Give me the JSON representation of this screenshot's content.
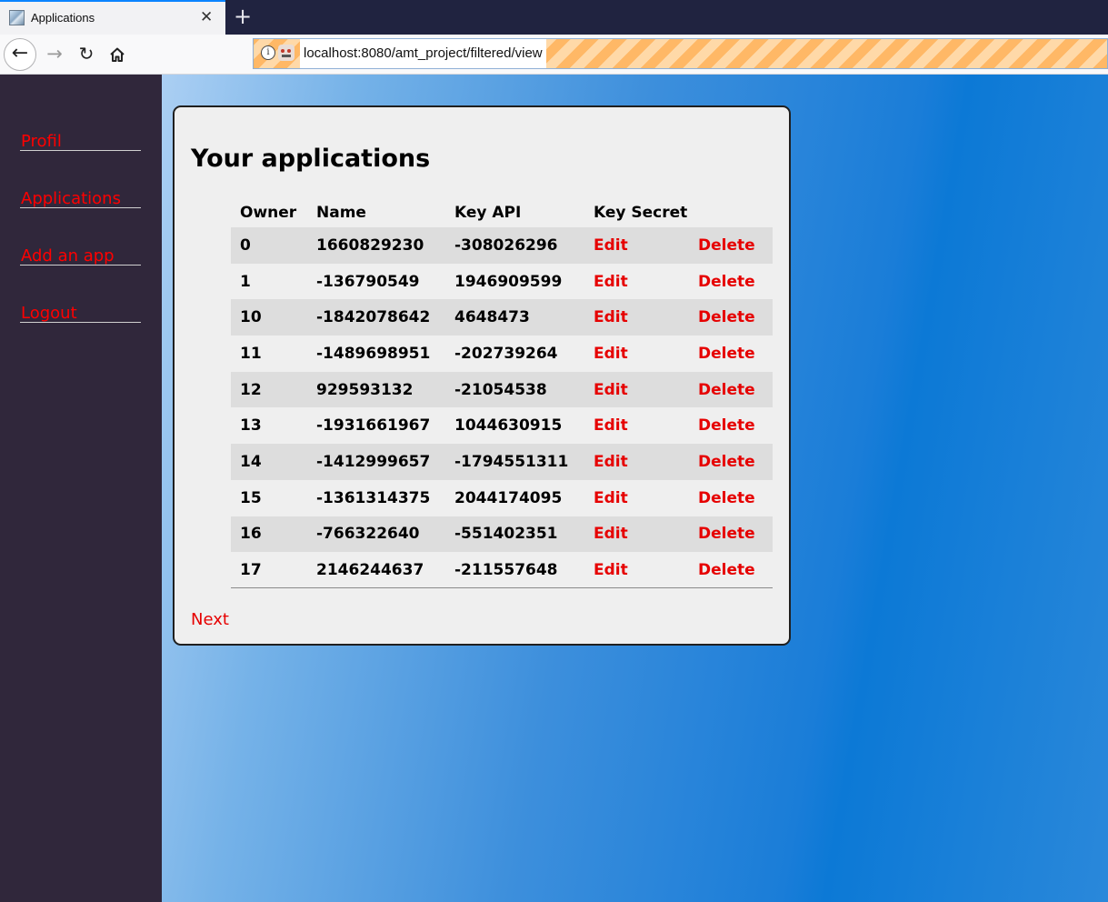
{
  "browser": {
    "tab_title": "Applications",
    "tab_close": "✕",
    "new_tab": "+",
    "url": "localhost:8080/amt_project/filtered/view",
    "nav_back": "←",
    "nav_forward": "→",
    "nav_reload": "↻"
  },
  "sidebar": {
    "items": [
      {
        "label": "Profil"
      },
      {
        "label": "Applications"
      },
      {
        "label": "Add an app"
      },
      {
        "label": "Logout"
      }
    ]
  },
  "main": {
    "title": "Your applications",
    "columns": {
      "owner": "Owner",
      "name": "Name",
      "key_api": "Key API",
      "key_secret": "Key Secret"
    },
    "rows": [
      {
        "owner": "0",
        "name": "1660829230",
        "key_api": "-308026296",
        "edit": "Edit",
        "delete": "Delete"
      },
      {
        "owner": "1",
        "name": "-136790549",
        "key_api": "1946909599",
        "edit": "Edit",
        "delete": "Delete"
      },
      {
        "owner": "10",
        "name": "-1842078642",
        "key_api": "4648473",
        "edit": "Edit",
        "delete": "Delete"
      },
      {
        "owner": "11",
        "name": "-1489698951",
        "key_api": "-202739264",
        "edit": "Edit",
        "delete": "Delete"
      },
      {
        "owner": "12",
        "name": "929593132",
        "key_api": "-21054538",
        "edit": "Edit",
        "delete": "Delete"
      },
      {
        "owner": "13",
        "name": "-1931661967",
        "key_api": "1044630915",
        "edit": "Edit",
        "delete": "Delete"
      },
      {
        "owner": "14",
        "name": "-1412999657",
        "key_api": "-1794551311",
        "edit": "Edit",
        "delete": "Delete"
      },
      {
        "owner": "15",
        "name": "-1361314375",
        "key_api": "2044174095",
        "edit": "Edit",
        "delete": "Delete"
      },
      {
        "owner": "16",
        "name": "-766322640",
        "key_api": "-551402351",
        "edit": "Edit",
        "delete": "Delete"
      },
      {
        "owner": "17",
        "name": "2146244637",
        "key_api": "-211557648",
        "edit": "Edit",
        "delete": "Delete"
      }
    ],
    "next_label": "Next"
  },
  "colors": {
    "sidebar_bg": "#30273b",
    "link_red": "#e60000",
    "card_bg": "#efefef"
  }
}
